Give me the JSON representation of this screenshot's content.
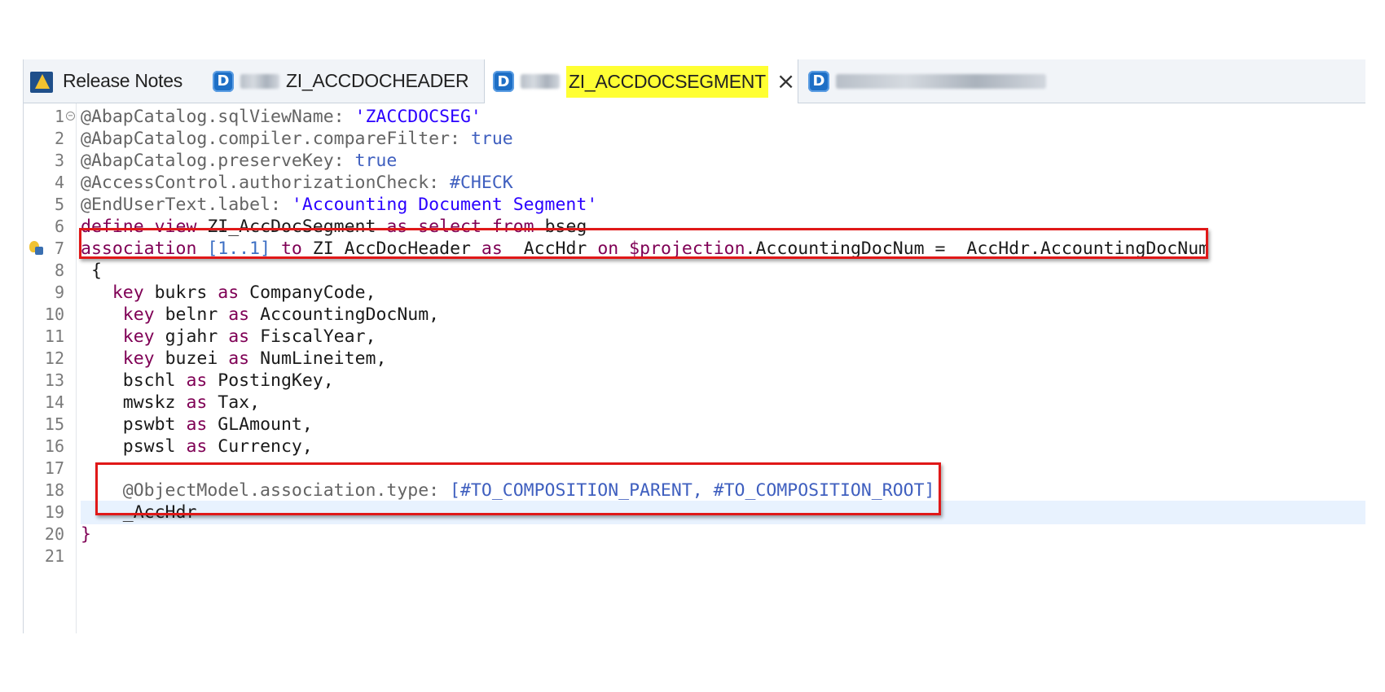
{
  "tabs": [
    {
      "label": "Release Notes",
      "icon": "release-notes-icon",
      "active": false
    },
    {
      "label": "ZI_ACCDOCHEADER",
      "icon": "ddl-source-icon",
      "active": false
    },
    {
      "label": "ZI_ACCDOCSEGMENT",
      "icon": "ddl-source-icon",
      "active": true
    },
    {
      "label": "",
      "icon": "ddl-source-icon",
      "active": false
    }
  ],
  "editor": {
    "line_numbers": [
      "1",
      "2",
      "3",
      "4",
      "5",
      "6",
      "7",
      "8",
      "9",
      "10",
      "11",
      "12",
      "13",
      "14",
      "15",
      "16",
      "17",
      "18",
      "19",
      "20",
      "21"
    ],
    "lines": [
      [
        {
          "c": "ann",
          "t": "@AbapCatalog.sqlViewName: "
        },
        {
          "c": "str",
          "t": "'ZACCDOCSEG'"
        }
      ],
      [
        {
          "c": "ann",
          "t": "@AbapCatalog.compiler.compareFilter: "
        },
        {
          "c": "ann2",
          "t": "true"
        }
      ],
      [
        {
          "c": "ann",
          "t": "@AbapCatalog.preserveKey: "
        },
        {
          "c": "ann2",
          "t": "true"
        }
      ],
      [
        {
          "c": "ann",
          "t": "@AccessControl.authorizationCheck: "
        },
        {
          "c": "ann2",
          "t": "#CHECK"
        }
      ],
      [
        {
          "c": "ann",
          "t": "@EndUserText.label: "
        },
        {
          "c": "str",
          "t": "'Accounting Document Segment'"
        }
      ],
      [
        {
          "c": "kw",
          "t": "define view "
        },
        {
          "c": "plain",
          "t": "ZI_AccDocSegment "
        },
        {
          "c": "kw",
          "t": "as select from "
        },
        {
          "c": "plain",
          "t": "bseg"
        }
      ],
      [
        {
          "c": "kw",
          "t": "association "
        },
        {
          "c": "num",
          "t": "[1..1] "
        },
        {
          "c": "kw",
          "t": "to "
        },
        {
          "c": "plain",
          "t": "ZI_AccDocHeader "
        },
        {
          "c": "kw",
          "t": "as "
        },
        {
          "c": "plain",
          "t": "_AccHdr "
        },
        {
          "c": "kw",
          "t": "on "
        },
        {
          "c": "kw",
          "t": "$projection"
        },
        {
          "c": "plain",
          "t": ".AccountingDocNum = _AccHdr.AccountingDocNum"
        }
      ],
      [
        {
          "c": "plain",
          "t": " {"
        }
      ],
      [
        {
          "c": "kw",
          "t": "   key "
        },
        {
          "c": "plain",
          "t": "bukrs "
        },
        {
          "c": "kw",
          "t": "as "
        },
        {
          "c": "plain",
          "t": "CompanyCode,"
        }
      ],
      [
        {
          "c": "kw",
          "t": "    key "
        },
        {
          "c": "plain",
          "t": "belnr "
        },
        {
          "c": "kw",
          "t": "as "
        },
        {
          "c": "plain",
          "t": "AccountingDocNum,"
        }
      ],
      [
        {
          "c": "kw",
          "t": "    key "
        },
        {
          "c": "plain",
          "t": "gjahr "
        },
        {
          "c": "kw",
          "t": "as "
        },
        {
          "c": "plain",
          "t": "FiscalYear,"
        }
      ],
      [
        {
          "c": "kw",
          "t": "    key "
        },
        {
          "c": "plain",
          "t": "buzei "
        },
        {
          "c": "kw",
          "t": "as "
        },
        {
          "c": "plain",
          "t": "NumLineitem,"
        }
      ],
      [
        {
          "c": "plain",
          "t": "    bschl "
        },
        {
          "c": "kw",
          "t": "as "
        },
        {
          "c": "plain",
          "t": "PostingKey,"
        }
      ],
      [
        {
          "c": "plain",
          "t": "    mwskz "
        },
        {
          "c": "kw",
          "t": "as "
        },
        {
          "c": "plain",
          "t": "Tax,"
        }
      ],
      [
        {
          "c": "plain",
          "t": "    pswbt "
        },
        {
          "c": "kw",
          "t": "as "
        },
        {
          "c": "plain",
          "t": "GLAmount,"
        }
      ],
      [
        {
          "c": "plain",
          "t": "    pswsl "
        },
        {
          "c": "kw",
          "t": "as "
        },
        {
          "c": "plain",
          "t": "Currency,"
        }
      ],
      [],
      [
        {
          "c": "ann",
          "t": "    @ObjectModel.association.type: "
        },
        {
          "c": "ann2",
          "t": "[#TO_COMPOSITION_PARENT, #TO_COMPOSITION_ROOT]"
        }
      ],
      [
        {
          "c": "plain",
          "t": "    _AccHdr"
        }
      ],
      [
        {
          "c": "kw",
          "t": "}"
        }
      ],
      []
    ],
    "current_line": 19,
    "fold_line": 1,
    "marker_line": 7
  }
}
